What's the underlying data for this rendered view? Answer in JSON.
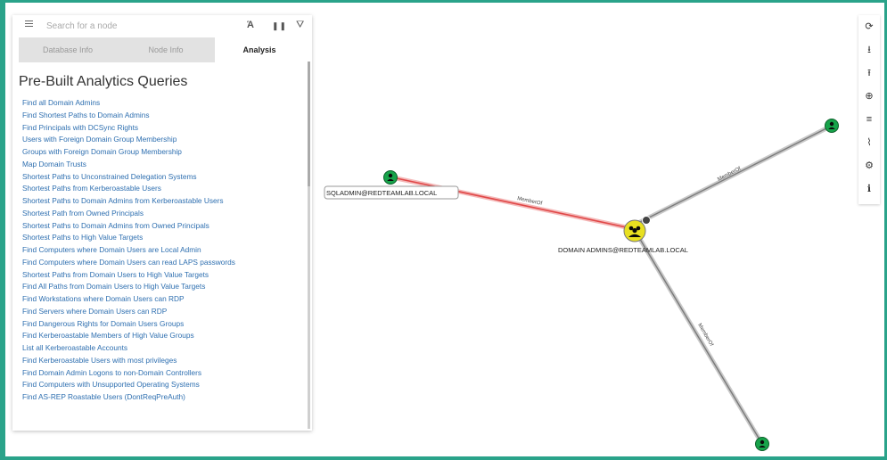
{
  "search": {
    "placeholder": "Search for a node"
  },
  "toolbar_icons": {
    "menu": "menu-icon",
    "pathfinding": "pathfinding-icon",
    "pause": "pause-icon",
    "filter": "filter-icon"
  },
  "tabs": [
    {
      "label": "Database Info"
    },
    {
      "label": "Node Info"
    },
    {
      "label": "Analysis"
    }
  ],
  "panel_title": "Pre-Built Analytics Queries",
  "queries": [
    "Find all Domain Admins",
    "Find Shortest Paths to Domain Admins",
    "Find Principals with DCSync Rights",
    "Users with Foreign Domain Group Membership",
    "Groups with Foreign Domain Group Membership",
    "Map Domain Trusts",
    "Shortest Paths to Unconstrained Delegation Systems",
    "Shortest Paths from Kerberoastable Users",
    "Shortest Paths to Domain Admins from Kerberoastable Users",
    "Shortest Path from Owned Principals",
    "Shortest Paths to Domain Admins from Owned Principals",
    "Shortest Paths to High Value Targets",
    "Find Computers where Domain Users are Local Admin",
    "Find Computers where Domain Users can read LAPS passwords",
    "Shortest Paths from Domain Users to High Value Targets",
    "Find All Paths from Domain Users to High Value Targets",
    "Find Workstations where Domain Users can RDP",
    "Find Servers where Domain Users can RDP",
    "Find Dangerous Rights for Domain Users Groups",
    "Find Kerberoastable Members of High Value Groups",
    "List all Kerberoastable Accounts",
    "Find Kerberoastable Users with most privileges",
    "Find Domain Admin Logons to non-Domain Controllers",
    "Find Computers with Unsupported Operating Systems",
    "Find AS-REP Roastable Users (DontReqPreAuth)"
  ],
  "right_toolbar": [
    {
      "name": "refresh-icon",
      "glyph": "⟳"
    },
    {
      "name": "export-icon",
      "glyph": "⭳"
    },
    {
      "name": "import-icon",
      "glyph": "⭱"
    },
    {
      "name": "upload-icon",
      "glyph": "⊕"
    },
    {
      "name": "list-icon",
      "glyph": "≡"
    },
    {
      "name": "chart-icon",
      "glyph": "⌇"
    },
    {
      "name": "settings-icon",
      "glyph": "⚙"
    },
    {
      "name": "info-icon",
      "glyph": "ℹ"
    }
  ],
  "graph": {
    "nodes": [
      {
        "id": "sqladmin",
        "label": "SQLADMIN@REDTEAMLAB.LOCAL",
        "type": "user"
      },
      {
        "id": "domainadmins",
        "label": "DOMAIN ADMINS@REDTEAMLAB.LOCAL",
        "type": "group"
      },
      {
        "id": "user2",
        "label": "",
        "type": "user"
      },
      {
        "id": "user3",
        "label": "",
        "type": "user"
      }
    ],
    "edges": [
      {
        "from": "sqladmin",
        "to": "domainadmins",
        "label": "MemberOf",
        "highlight": true
      },
      {
        "from": "user2",
        "to": "domainadmins",
        "label": "MemberOf",
        "highlight": false
      },
      {
        "from": "user3",
        "to": "domainadmins",
        "label": "MemberOf",
        "highlight": false
      }
    ]
  },
  "colors": {
    "accent": "#2aa38a",
    "link": "#2e6fb0",
    "user_node": "#17a34a",
    "group_node": "#e8e020",
    "highlight_edge": "#e04848"
  }
}
